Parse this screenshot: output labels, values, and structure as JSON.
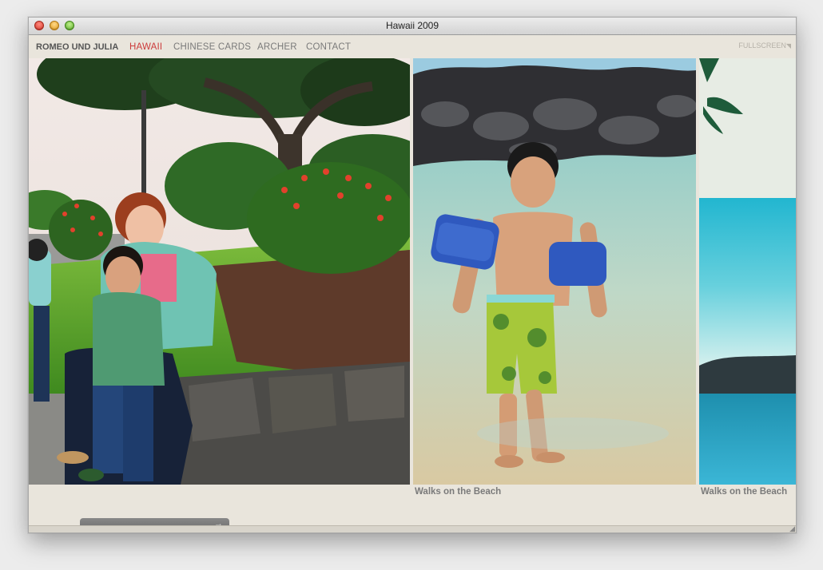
{
  "window": {
    "title": "Hawaii 2009"
  },
  "nav": {
    "brand": "ROMEO UND JULIA",
    "items": [
      "HAWAII",
      "CHINESE CARDS",
      "ARCHER",
      "CONTACT"
    ],
    "active": "HAWAII",
    "fullscreen": "FULLSCREEN"
  },
  "gallery": {
    "photos": [
      {
        "caption": ""
      },
      {
        "caption": "Walks on the Beach"
      },
      {
        "caption": "Walks on the Beach"
      }
    ]
  },
  "scroller": {
    "arrow": "→"
  },
  "colors": {
    "accent": "#cc3a3a",
    "background": "#e9e5dc"
  }
}
